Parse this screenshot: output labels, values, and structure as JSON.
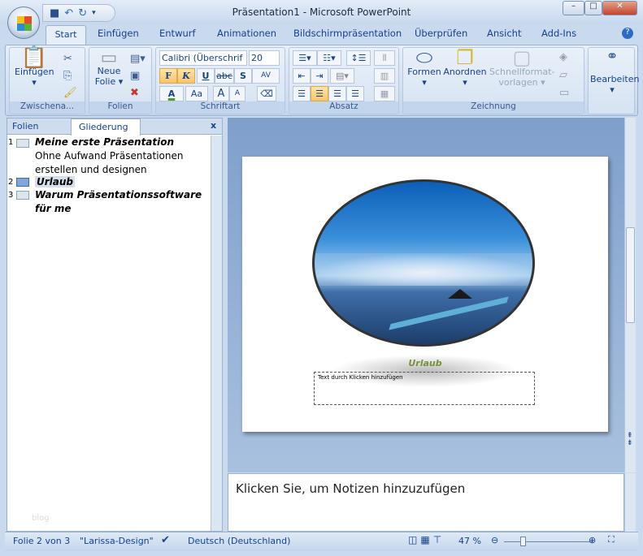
{
  "window": {
    "title": "Präsentation1 - Microsoft PowerPoint",
    "minimize": "–",
    "maximize": "□",
    "close": "✕"
  },
  "tabs": [
    "Start",
    "Einfügen",
    "Entwurf",
    "Animationen",
    "Bildschirmpräsentation",
    "Überprüfen",
    "Ansicht",
    "Add-Ins"
  ],
  "ribbon": {
    "clipboard": {
      "label": "Zwischena...",
      "paste": "Einfügen"
    },
    "slides": {
      "label": "Folien",
      "new_slide_1": "Neue",
      "new_slide_2": "Folie"
    },
    "font": {
      "label": "Schriftart",
      "font_name": "Calibri (Überschrif",
      "font_size": "20",
      "bold": "F",
      "italic": "K",
      "underline": "U",
      "strike": "abc",
      "shadow": "S",
      "spacing": "AV",
      "color": "A",
      "case": "Aa",
      "grow": "A",
      "shrink": "A"
    },
    "paragraph": {
      "label": "Absatz"
    },
    "drawing": {
      "label": "Zeichnung",
      "shapes": "Formen",
      "arrange": "Anordnen",
      "quickstyles_1": "Schnellformat-",
      "quickstyles_2": "vorlagen"
    },
    "editing": {
      "label": "Bearbeiten"
    }
  },
  "left_pane": {
    "tabs": [
      "Folien",
      "Gliederung"
    ],
    "close": "x",
    "outline": [
      {
        "num": "1",
        "title": "Meine erste Präsentation",
        "body": [
          "Ohne Aufwand  Präsentationen",
          "erstellen und designen"
        ]
      },
      {
        "num": "2",
        "title": "Urlaub",
        "body": []
      },
      {
        "num": "3",
        "title": "Warum Präsentationssoftware",
        "title2": "für me",
        "body": []
      }
    ],
    "watermark": "blog"
  },
  "slide": {
    "title": "Urlaub",
    "placeholder": "Text durch Klicken hinzufügen"
  },
  "notes": {
    "placeholder": "Klicken Sie, um  Notizen hinzuzufügen"
  },
  "status": {
    "slide": "Folie 2 von 3",
    "theme": "\"Larissa-Design\"",
    "language": "Deutsch (Deutschland)",
    "zoom": "47 %",
    "zoom_percent": 47
  },
  "colors": {
    "slide_title": "#76923c",
    "accent": "#f8c46a"
  }
}
